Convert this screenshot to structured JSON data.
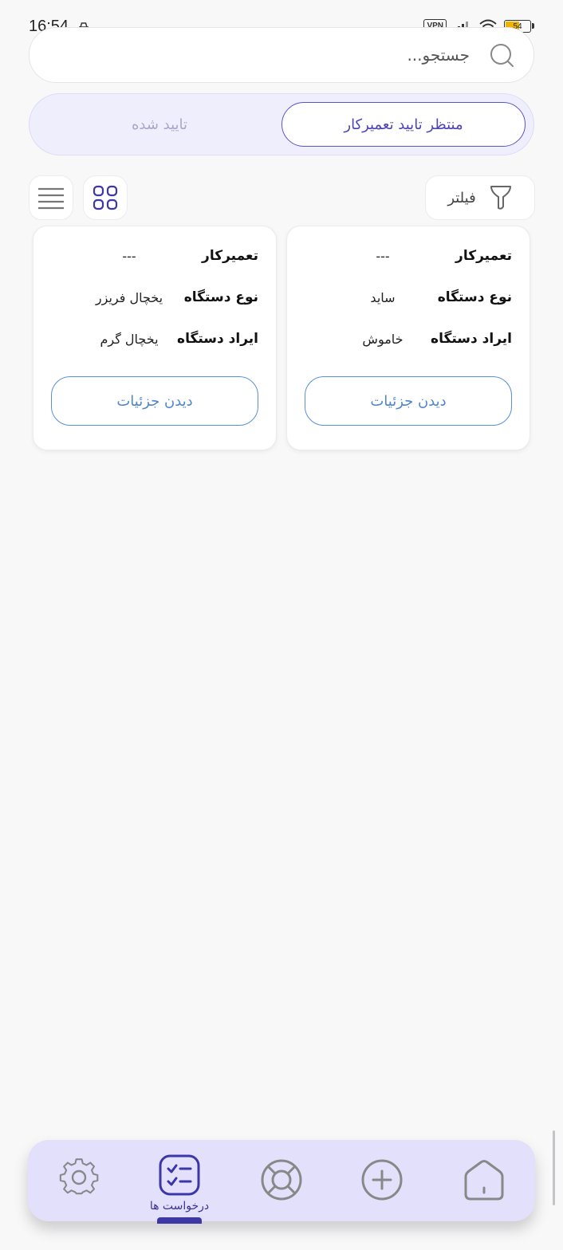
{
  "status_bar": {
    "time": "16:54",
    "vpn": "VPN",
    "battery": "54"
  },
  "search": {
    "placeholder": "جستجو..."
  },
  "tabs": [
    {
      "label": "منتظر تایید تعمیرکار",
      "active": true
    },
    {
      "label": "تایید شده",
      "active": false
    }
  ],
  "toolbar": {
    "filter_label": "فیلتر"
  },
  "cards": [
    {
      "rows": [
        {
          "key": "تعمیرکار",
          "value": "---"
        },
        {
          "key": "نوع دستگاه",
          "value": "ساید"
        },
        {
          "key": "ایراد دستگاه",
          "value": "خاموش"
        }
      ],
      "button": "دیدن جزئیات"
    },
    {
      "rows": [
        {
          "key": "تعمیرکار",
          "value": "---"
        },
        {
          "key": "نوع دستگاه",
          "value": "یخچال فریزر"
        },
        {
          "key": "ایراد دستگاه",
          "value": "یخچال گرم"
        }
      ],
      "button": "دیدن جزئیات"
    }
  ],
  "bottom_nav": {
    "active_label": "درخواست ها",
    "items": [
      "settings-icon",
      "requests-icon",
      "support-icon",
      "add-icon",
      "home-icon"
    ]
  },
  "colors": {
    "accent": "#4b45b8",
    "button_border": "#5a8fd6",
    "nav_bg": "#e2e0fb"
  }
}
